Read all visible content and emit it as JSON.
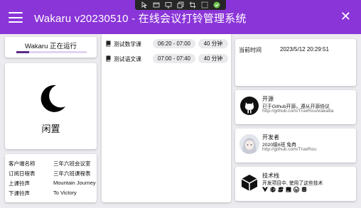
{
  "window": {
    "title": "Wakaru v20230510 - 在线会议打铃管理系统",
    "close_glyph": "✕"
  },
  "overlay_toolbar": {
    "icons": [
      "cursor-icon",
      "window-icon",
      "screen-icon",
      "copy-icon",
      "crop-icon",
      "region-icon",
      "check-icon"
    ]
  },
  "status": {
    "text": "Wakaru 正在运行",
    "progress": 0.18
  },
  "idle": {
    "label": "闲置"
  },
  "client_info": {
    "rows": [
      {
        "key": "客户端名称",
        "value": "三年六班会议室"
      },
      {
        "key": "订阅日程表",
        "value": "三年六班课程表"
      },
      {
        "key": "上课铃声",
        "value": "Mountain Journey"
      },
      {
        "key": "下课铃声",
        "value": "To Victory"
      }
    ]
  },
  "schedule": {
    "rows": [
      {
        "course": "测试数学课",
        "time": "06:20 - 07:00",
        "duration": "40 分钟"
      },
      {
        "course": "测试语文课",
        "time": "07:00 - 07:40",
        "duration": "40 分钟"
      }
    ]
  },
  "current_time": {
    "label": "当前时间",
    "value": "2023/5/12 20:29:51"
  },
  "open_source": {
    "title": "开源",
    "line": "已于Github开源，遵从开源协议",
    "link": "http://github.com/TrueRou/wakatta"
  },
  "developer": {
    "title": "开发者",
    "line": "2020级6班 免冉",
    "link": "http://github.com/TrueRou"
  },
  "tech_stack": {
    "title": "技术栈",
    "line": "开发项目中, 使用了这些技术",
    "icons": [
      "vue-icon",
      "csharp-icon",
      "python-icon",
      "jetbrains-icon",
      "wordpress-icon",
      "database-icon"
    ]
  },
  "colors": {
    "titlebar": "#8a35d8",
    "progress": "#5a2a8a",
    "background": "#ecebef"
  }
}
